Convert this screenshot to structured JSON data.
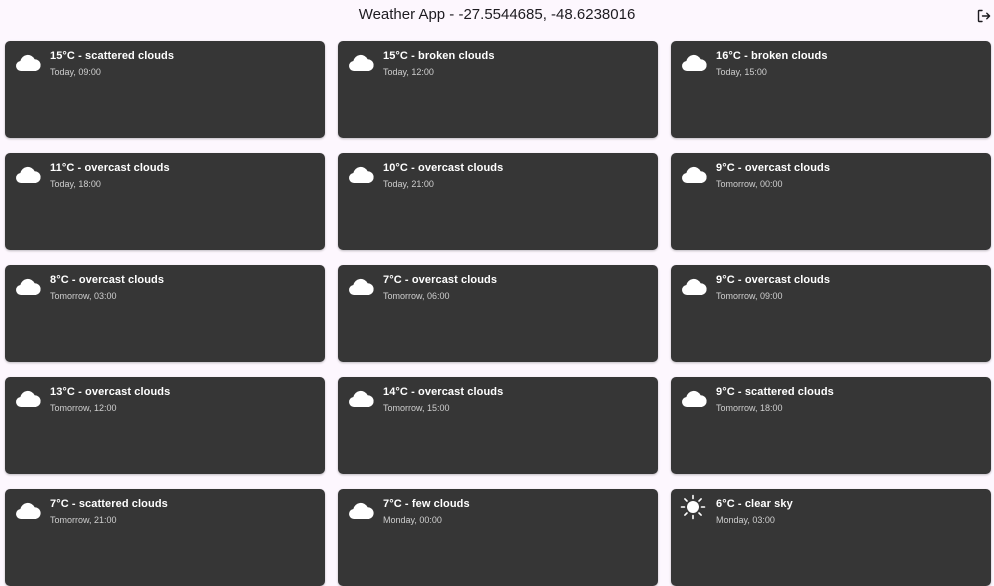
{
  "app": {
    "title": "Weather App - -27.5544685, -48.6238016",
    "logout_icon": "logout-icon"
  },
  "forecasts": [
    {
      "title": "15°C - scattered clouds",
      "time": "Today, 09:00",
      "icon": "cloud-icon"
    },
    {
      "title": "15°C - broken clouds",
      "time": "Today, 12:00",
      "icon": "cloud-icon"
    },
    {
      "title": "16°C - broken clouds",
      "time": "Today, 15:00",
      "icon": "cloud-icon"
    },
    {
      "title": "11°C - overcast clouds",
      "time": "Today, 18:00",
      "icon": "cloud-icon"
    },
    {
      "title": "10°C - overcast clouds",
      "time": "Today, 21:00",
      "icon": "cloud-icon"
    },
    {
      "title": "9°C - overcast clouds",
      "time": "Tomorrow, 00:00",
      "icon": "cloud-icon"
    },
    {
      "title": "8°C - overcast clouds",
      "time": "Tomorrow, 03:00",
      "icon": "cloud-icon"
    },
    {
      "title": "7°C - overcast clouds",
      "time": "Tomorrow, 06:00",
      "icon": "cloud-icon"
    },
    {
      "title": "9°C - overcast clouds",
      "time": "Tomorrow, 09:00",
      "icon": "cloud-icon"
    },
    {
      "title": "13°C - overcast clouds",
      "time": "Tomorrow, 12:00",
      "icon": "cloud-icon"
    },
    {
      "title": "14°C - overcast clouds",
      "time": "Tomorrow, 15:00",
      "icon": "cloud-icon"
    },
    {
      "title": "9°C - scattered clouds",
      "time": "Tomorrow, 18:00",
      "icon": "cloud-icon"
    },
    {
      "title": "7°C - scattered clouds",
      "time": "Tomorrow, 21:00",
      "icon": "cloud-icon"
    },
    {
      "title": "7°C - few clouds",
      "time": "Monday, 00:00",
      "icon": "cloud-icon"
    },
    {
      "title": "6°C - clear sky",
      "time": "Monday, 03:00",
      "icon": "sun-icon"
    }
  ],
  "colors": {
    "background": "#fdf7fe",
    "card": "#363636",
    "card_text": "#ffffff",
    "card_subtext": "#cfcfcf"
  }
}
